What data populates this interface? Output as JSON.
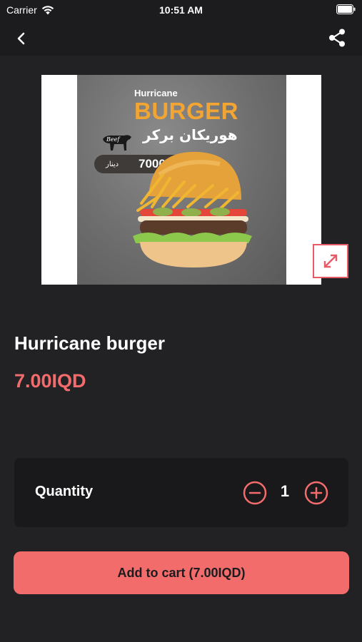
{
  "status_bar": {
    "carrier": "Carrier",
    "time": "10:51 AM"
  },
  "nav": {
    "back_icon": "chevron-left-icon",
    "share_icon": "share-icon"
  },
  "product_image": {
    "poster_title_small": "Hurricane",
    "poster_title_large": "BURGER",
    "poster_arabic_name": "هوريكان بركر",
    "poster_price": "7000",
    "poster_currency": "دينار",
    "expand_icon": "expand-icon"
  },
  "product": {
    "name": "Hurricane burger",
    "price": "7.00IQD"
  },
  "quantity": {
    "label": "Quantity",
    "value": "1"
  },
  "cart": {
    "add_label": "Add to cart (7.00IQD)"
  },
  "colors": {
    "accent": "#f36c6c",
    "background": "#222225",
    "card": "#19191b"
  }
}
